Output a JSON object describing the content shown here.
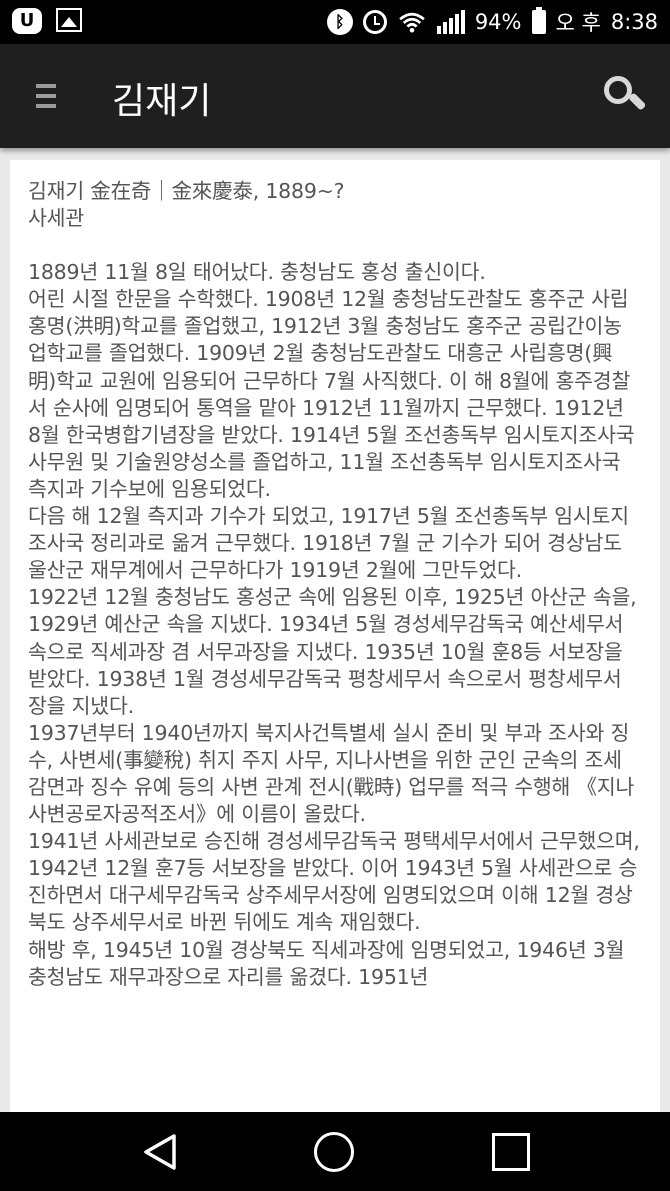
{
  "status_bar": {
    "carrier_icon": "u-plus-icon",
    "carrier_label": "U",
    "battery_percent": "94%",
    "ampm": "오 후",
    "time": "8:38",
    "icons": [
      "gallery-icon",
      "bluetooth-icon",
      "alarm-icon",
      "wifi-icon",
      "signal-icon",
      "battery-icon"
    ]
  },
  "app_bar": {
    "title": "김재기",
    "menu_icon": "menu-icon",
    "search_icon": "search-icon"
  },
  "article": {
    "heading": "김재기 金在奇｜金來慶泰, 1889~?",
    "subheading": "사세관",
    "paragraphs": [
      "1889년 11월 8일 태어났다. 충청남도 홍성 출신이다.",
      "어린 시절 한문을 수학했다. 1908년 12월 충청남도관찰도 홍주군 사립 홍명(洪明)학교를 졸업했고, 1912년 3월 충청남도 홍주군 공립간이농업학교를 졸업했다. 1909년 2월 충청남도관찰도 대흥군 사립흥명(興明)학교 교원에 임용되어 근무하다 7월 사직했다. 이 해 8월에 홍주경찰서 순사에 임명되어 통역을 맡아 1912년 11월까지 근무했다. 1912년 8월 한국병합기념장을 받았다. 1914년 5월 조선총독부 임시토지조사국 사무원 및 기술원양성소를 졸업하고, 11월 조선총독부 임시토지조사국 측지과 기수보에 임용되었다.",
      "다음 해 12월 측지과 기수가 되었고, 1917년 5월 조선총독부 임시토지조사국 정리과로 옮겨 근무했다. 1918년 7월 군 기수가 되어 경상남도 울산군 재무계에서 근무하다가 1919년 2월에 그만두었다.",
      "1922년 12월 충청남도 홍성군 속에 임용된 이후, 1925년 아산군 속을, 1929년 예산군 속을 지냈다. 1934년 5월 경성세무감독국 예산세무서 속으로 직세과장 겸 서무과장을 지냈다. 1935년 10월 훈8등 서보장을 받았다. 1938년 1월 경성세무감독국 평창세무서 속으로서 평창세무서장을 지냈다.",
      "1937년부터 1940년까지 북지사건특별세 실시 준비 및 부과 조사와 징수, 사변세(事變稅) 취지 주지 사무, 지나사변을 위한 군인 군속의 조세 감면과 징수 유예 등의 사변 관계 전시(戰時) 업무를 적극 수행해 《지나사변공로자공적조서》에 이름이 올랐다.",
      "1941년 사세관보로 승진해 경성세무감독국 평택세무서에서 근무했으며, 1942년 12월 훈7등 서보장을 받았다. 이어 1943년 5월 사세관으로 승진하면서 대구세무감독국 상주세무서장에 임명되었으며 이해 12월 경상북도 상주세무서로 바뀐 뒤에도 계속 재임했다.",
      "해방 후, 1945년 10월 경상북도 직세과장에 임명되었고, 1946년 3월 충청남도 재무과장으로 자리를 옮겼다. 1951년"
    ]
  },
  "nav_bar": {
    "icons": [
      "back-icon",
      "home-icon",
      "recent-apps-icon"
    ]
  }
}
